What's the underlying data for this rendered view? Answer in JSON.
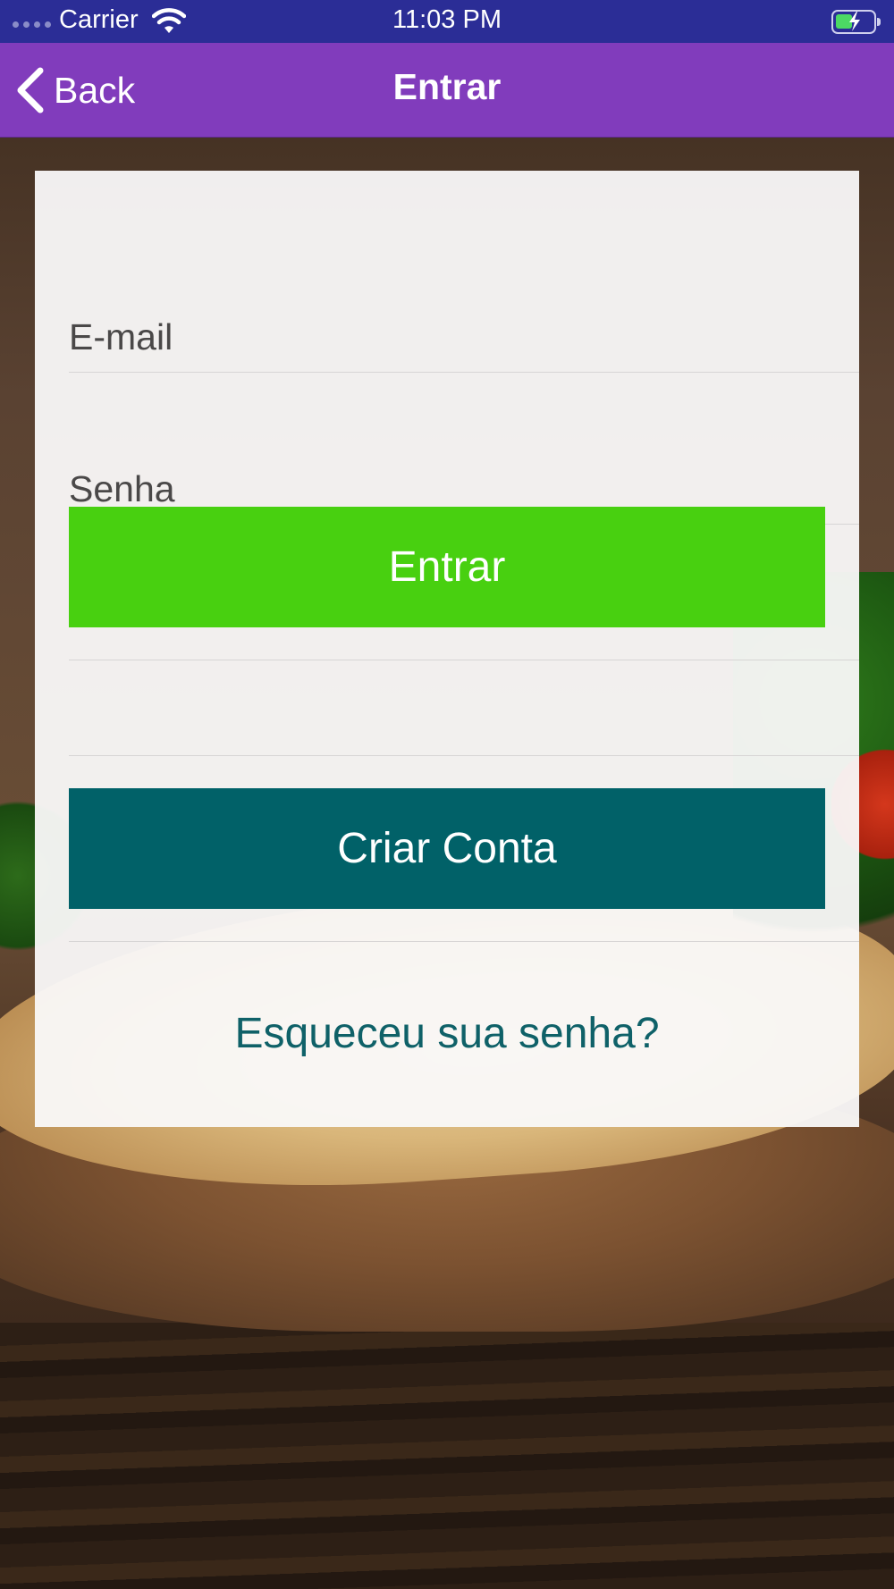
{
  "status_bar": {
    "carrier": "Carrier",
    "time": "11:03 PM"
  },
  "nav": {
    "back_label": "Back",
    "title": "Entrar"
  },
  "form": {
    "email_placeholder": "E-mail",
    "password_placeholder": "Senha",
    "login_button": "Entrar",
    "create_account_button": "Criar Conta",
    "forgot_password_link": "Esqueceu sua senha?"
  },
  "colors": {
    "status_bar": "#2b2d96",
    "nav_bar": "#813cbc",
    "login_button": "#48d010",
    "create_account_button": "#016168",
    "link": "#0f6168"
  }
}
